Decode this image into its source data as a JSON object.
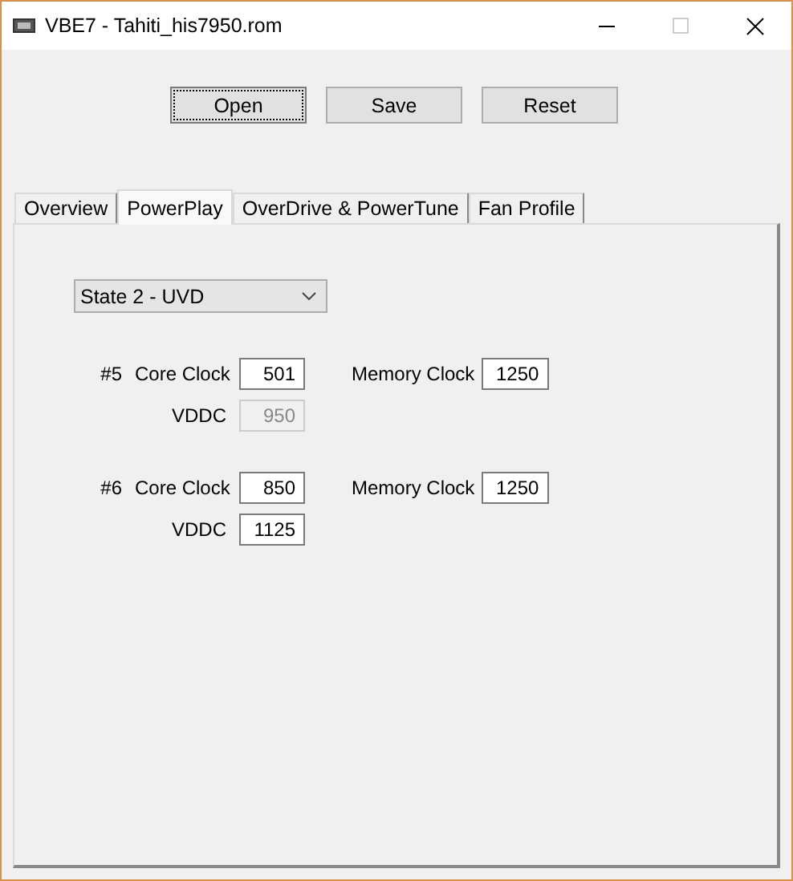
{
  "window": {
    "title": "VBE7 - Tahiti_his7950.rom"
  },
  "buttons": [
    {
      "label": "Open",
      "focused": true
    },
    {
      "label": "Save",
      "focused": false
    },
    {
      "label": "Reset",
      "focused": false
    }
  ],
  "tabs": [
    {
      "label": "Overview",
      "selected": false
    },
    {
      "label": "PowerPlay",
      "selected": true
    },
    {
      "label": "OverDrive & PowerTune",
      "selected": false
    },
    {
      "label": "Fan Profile",
      "selected": false
    }
  ],
  "state_select": {
    "value": "State 2 - UVD"
  },
  "states": [
    {
      "index": "#5",
      "core_label": "Core Clock",
      "core_clock": "501",
      "memory_label": "Memory Clock",
      "memory_clock": "1250",
      "vddc_label": "VDDC",
      "vddc": "950",
      "vddc_disabled": true
    },
    {
      "index": "#6",
      "core_label": "Core Clock",
      "core_clock": "850",
      "memory_label": "Memory Clock",
      "memory_clock": "1250",
      "vddc_label": "VDDC",
      "vddc": "1125",
      "vddc_disabled": false
    }
  ]
}
